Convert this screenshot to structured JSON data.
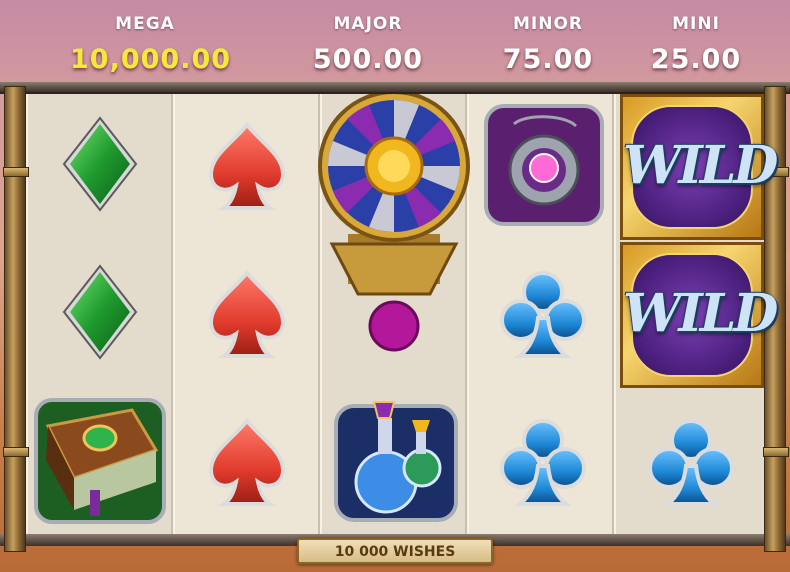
{
  "jackpots": [
    {
      "label": "MEGA",
      "value": "10,000.00"
    },
    {
      "label": "MAJOR",
      "value": "500.00"
    },
    {
      "label": "MINOR",
      "value": "75.00"
    },
    {
      "label": "MINI",
      "value": "25.00"
    }
  ],
  "reels": {
    "reel1": [
      "diamond",
      "diamond",
      "spellbook"
    ],
    "reel2": [
      "spade",
      "spade",
      "spade"
    ],
    "reel3": [
      "wheel-bonus",
      "magic-potion"
    ],
    "reel4": [
      "amulet",
      "club",
      "club"
    ],
    "reel5": [
      "wild",
      "wild",
      "club"
    ]
  },
  "wild_label": "WILD",
  "bet_banner": "10 000 WISHES",
  "colors": {
    "diamond": "#1f9a2e",
    "spade": "#e03b2d",
    "club": "#1e88d6",
    "mega_value": "#f6e83a"
  }
}
